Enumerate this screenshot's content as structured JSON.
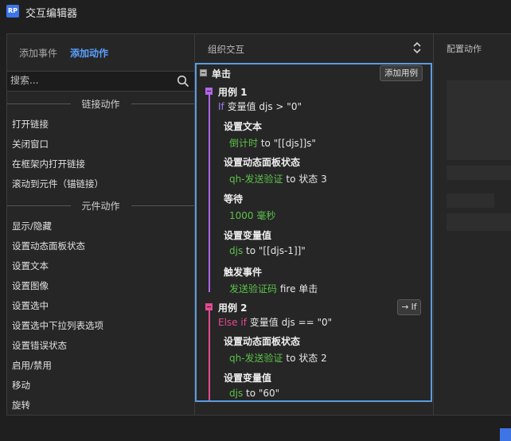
{
  "app": {
    "logo_text": "RP",
    "title": "交互编辑器"
  },
  "left": {
    "tabs": [
      {
        "label": "添加事件"
      },
      {
        "label": "添加动作"
      }
    ],
    "search": {
      "placeholder": "搜索..."
    },
    "groups": [
      {
        "title": "链接动作",
        "items": [
          "打开链接",
          "关闭窗口",
          "在框架内打开链接",
          "滚动到元件（锚链接）"
        ]
      },
      {
        "title": "元件动作",
        "items": [
          "显示/隐藏",
          "设置动态面板状态",
          "设置文本",
          "设置图像",
          "设置选中",
          "设置选中下拉列表选项",
          "设置错误状态",
          "启用/禁用",
          "移动",
          "旋转"
        ]
      }
    ]
  },
  "middle": {
    "title": "组织交互",
    "event": {
      "label": "单击",
      "add_case_label": "添加用例"
    },
    "cases": [
      {
        "label": "用例 1",
        "cond_kw": "If",
        "cond_text": "变量值 djs > \"0\"",
        "actions": [
          {
            "title": "设置文本",
            "target": "倒计时",
            "detail": "to \"[[djs]]s\""
          },
          {
            "title": "设置动态面板状态",
            "target": "qh-发送验证",
            "detail": "to 状态 3"
          },
          {
            "title": "等待",
            "target": "1000 毫秒",
            "detail": ""
          },
          {
            "title": "设置变量值",
            "target": "djs",
            "detail": "to \"[[djs-1]]\""
          },
          {
            "title": "触发事件",
            "target": "发送验证码",
            "detail": "fire 单击"
          }
        ]
      },
      {
        "label": "用例 2",
        "cond_kw": "Else if",
        "cond_text": "变量值 djs == \"0\"",
        "toggle_label": "→ If",
        "actions": [
          {
            "title": "设置动态面板状态",
            "target": "qh-发送验证",
            "detail": "to 状态 2"
          },
          {
            "title": "设置变量值",
            "target": "djs",
            "detail": "to \"60\""
          }
        ]
      }
    ]
  },
  "right": {
    "title": "配置动作"
  },
  "colors": {
    "accent": "#5aa0ff",
    "case_border": "#5b9be0",
    "case1": "#b066e8",
    "case2": "#e6498f",
    "target_green": "#5cc04a",
    "cond_purple": "#a07ae8"
  }
}
